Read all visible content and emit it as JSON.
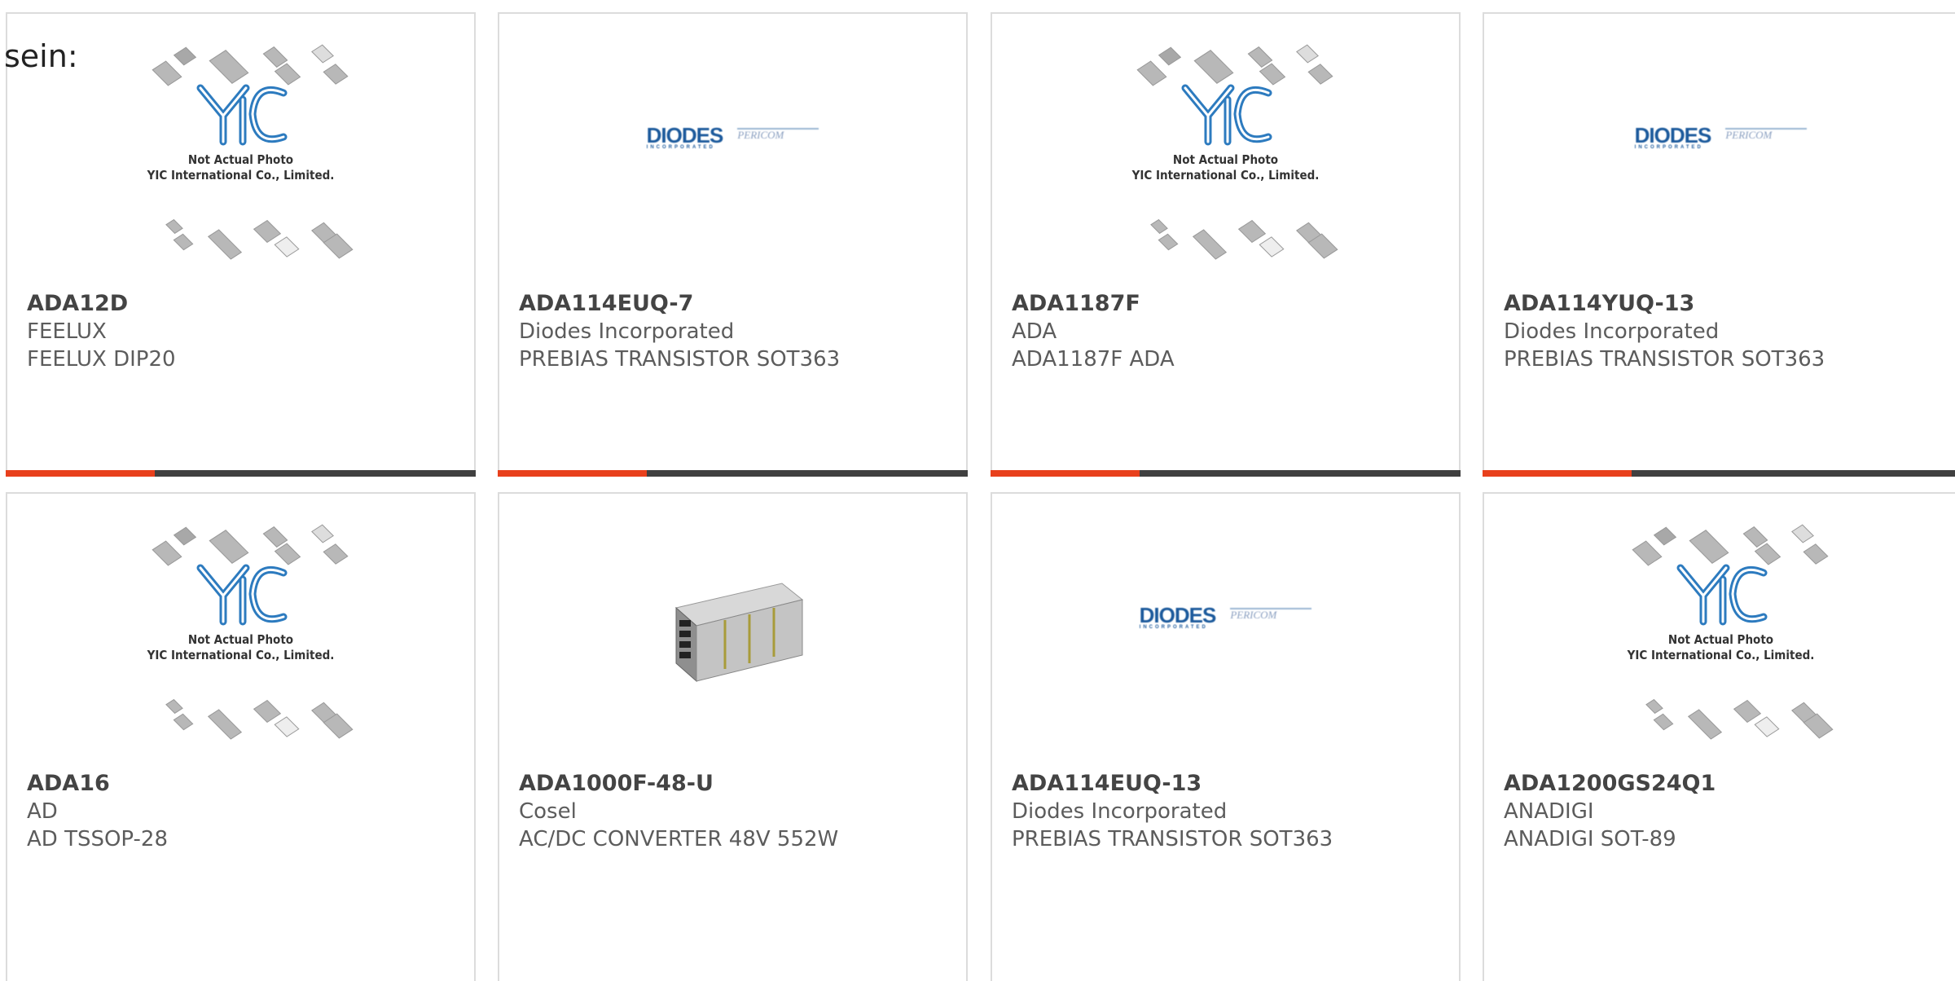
{
  "intro_text": "sein:",
  "colors": {
    "accent": "#e8401c",
    "bar": "#404040",
    "diodes_blue": "#1c5a9c",
    "yic_blue": "#2d7bbf"
  },
  "products": [
    {
      "part_number": "ADA12D",
      "manufacturer": "FEELUX",
      "description": "FEELUX DIP20",
      "image": "placeholder"
    },
    {
      "part_number": "ADA114EUQ-7",
      "manufacturer": "Diodes Incorporated",
      "description": "PREBIAS TRANSISTOR SOT363",
      "image": "diodes-logo"
    },
    {
      "part_number": "ADA1187F",
      "manufacturer": "ADA",
      "description": "ADA1187F ADA",
      "image": "placeholder"
    },
    {
      "part_number": "ADA114YUQ-13",
      "manufacturer": "Diodes Incorporated",
      "description": "PREBIAS TRANSISTOR SOT363",
      "image": "diodes-logo"
    },
    {
      "part_number": "ADA16",
      "manufacturer": "AD",
      "description": "AD TSSOP-28",
      "image": "placeholder"
    },
    {
      "part_number": "ADA1000F-48-U",
      "manufacturer": "Cosel",
      "description": "AC/DC CONVERTER 48V 552W",
      "image": "power-supply-photo"
    },
    {
      "part_number": "ADA114EUQ-13",
      "manufacturer": "Diodes Incorporated",
      "description": "PREBIAS TRANSISTOR SOT363",
      "image": "diodes-logo"
    },
    {
      "part_number": "ADA1200GS24Q1",
      "manufacturer": "ANADIGI",
      "description": "ANADIGI SOT-89",
      "image": "placeholder"
    }
  ],
  "placeholder": {
    "logo_text": "YIC",
    "caption_line1": "Not Actual Photo",
    "caption_line2": "YIC International Co., Limited."
  },
  "diodes_logo": {
    "brand": "DIODES",
    "sub": "INCORPORATED",
    "partner": "PERICOM"
  }
}
